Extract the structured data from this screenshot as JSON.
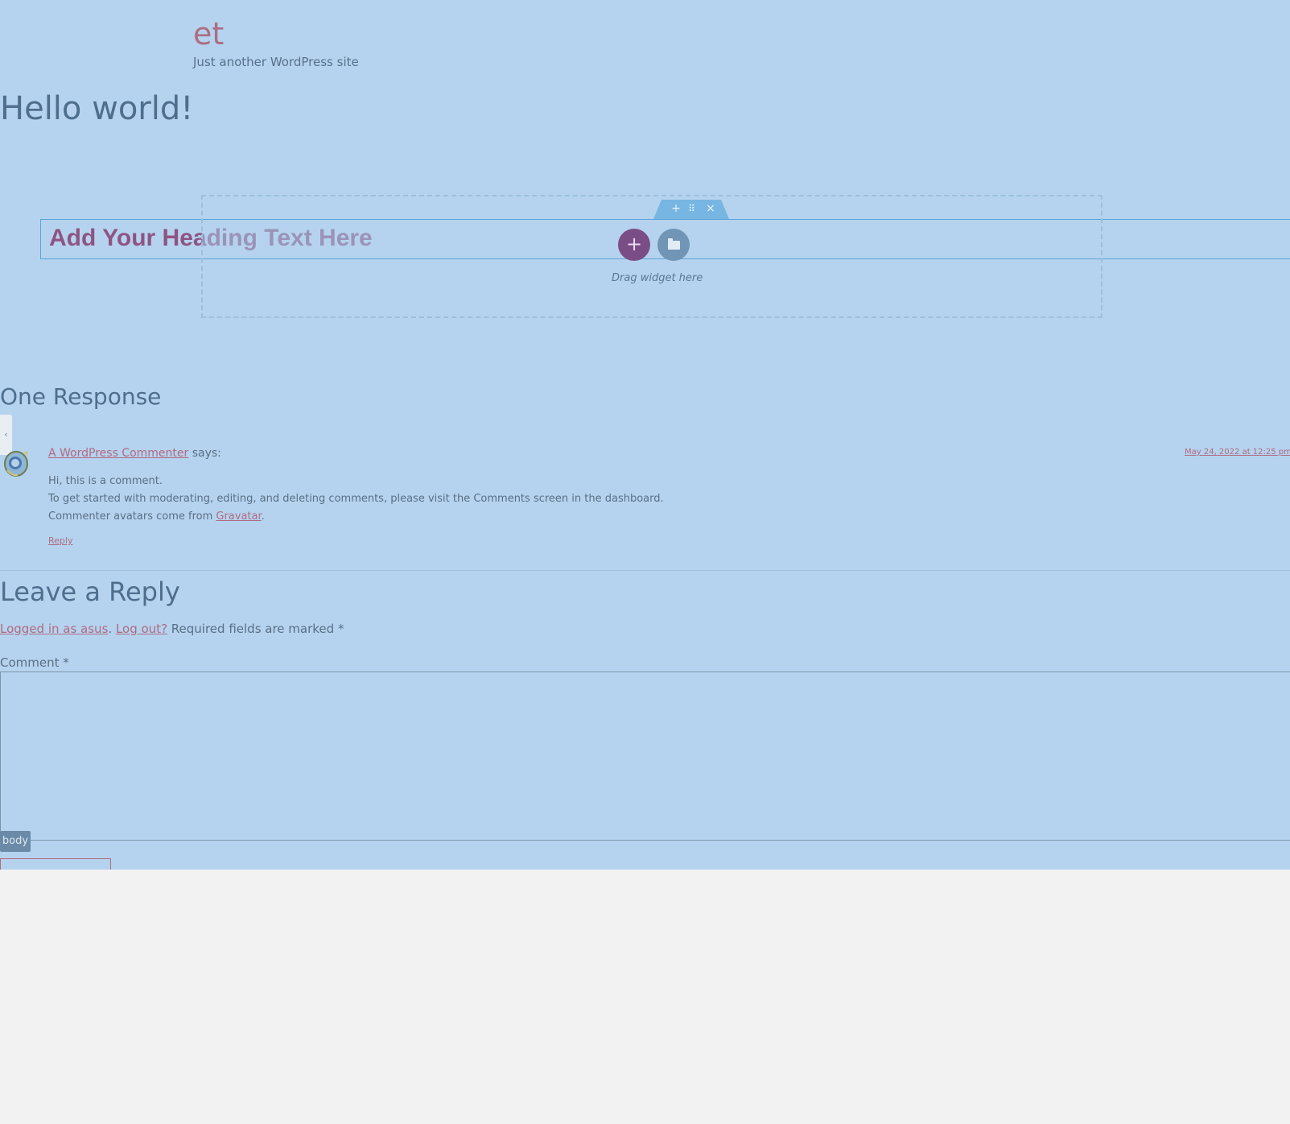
{
  "site": {
    "title": "et",
    "tagline": "Just another WordPress site"
  },
  "post": {
    "title": "Hello world!"
  },
  "editor": {
    "heading_widget_text": "Add Your Heading Text Here",
    "section_tab": {
      "add_icon": "plus-icon",
      "move_icon": "drag-handle-icon",
      "close_icon": "close-icon"
    },
    "add_button_glyph": "+",
    "drop_hint": "Drag widget here",
    "element_tag": "body"
  },
  "comments": {
    "title": "One Response",
    "items": [
      {
        "author": "A WordPress Commenter",
        "says": " says:",
        "date": "May 24, 2022 at 12:25 pm",
        "lines": [
          "Hi, this is a comment.",
          "To get started with moderating, editing, and deleting comments, please visit the Comments screen in the dashboard."
        ],
        "avatar_line_prefix": "Commenter avatars come from ",
        "avatar_link": "Gravatar",
        "avatar_line_suffix": ".",
        "reply": "Reply"
      }
    ]
  },
  "reply_form": {
    "title": "Leave a Reply",
    "logged_in_link": "Logged in as asus",
    "separator": ". ",
    "logout_link": "Log out?",
    "required_note": " Required fields are marked *",
    "comment_label": "Comment *"
  },
  "colors": {
    "overlay": "#b5d3ee",
    "link": "#b06b82",
    "heading": "#4e6e8e",
    "accent_purple": "#7b4d87"
  }
}
